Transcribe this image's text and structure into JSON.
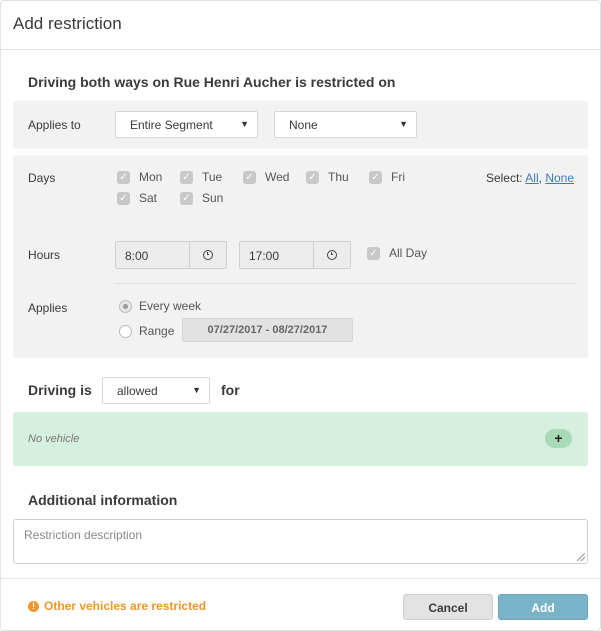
{
  "dialog": {
    "title": "Add restriction"
  },
  "restriction": {
    "heading": "Driving both ways on Rue Henri Aucher is restricted on",
    "applies_to_label": "Applies to",
    "applies_to_value": "Entire Segment",
    "segment_sub_value": "None"
  },
  "days": {
    "label": "Days",
    "items": [
      {
        "label": "Mon",
        "checked": true
      },
      {
        "label": "Tue",
        "checked": true
      },
      {
        "label": "Wed",
        "checked": true
      },
      {
        "label": "Thu",
        "checked": true
      },
      {
        "label": "Fri",
        "checked": true
      },
      {
        "label": "Sat",
        "checked": true
      },
      {
        "label": "Sun",
        "checked": true
      }
    ],
    "select_prefix": "Select:",
    "select_all": "All",
    "select_none": "None"
  },
  "hours": {
    "label": "Hours",
    "from": "8:00",
    "to": "17:00",
    "all_day_label": "All Day",
    "all_day_checked": true
  },
  "applies": {
    "label": "Applies",
    "every_week_label": "Every week",
    "every_week_selected": true,
    "range_label": "Range",
    "range_value": "07/27/2017 - 08/27/2017"
  },
  "driving": {
    "prefix": "Driving is",
    "value": "allowed",
    "suffix": "for"
  },
  "vehicles": {
    "empty_text": "No vehicle",
    "add_icon": "+"
  },
  "additional": {
    "heading": "Additional information",
    "placeholder": "Restriction description"
  },
  "footer": {
    "warning_icon": "!",
    "warning": "Other vehicles are restricted",
    "cancel_label": "Cancel",
    "add_label": "Add"
  },
  "colors": {
    "accent": "#79b3c8",
    "warning": "#f0962a",
    "vehicle_panel": "#d5f0de",
    "link": "#3d7ab8"
  }
}
